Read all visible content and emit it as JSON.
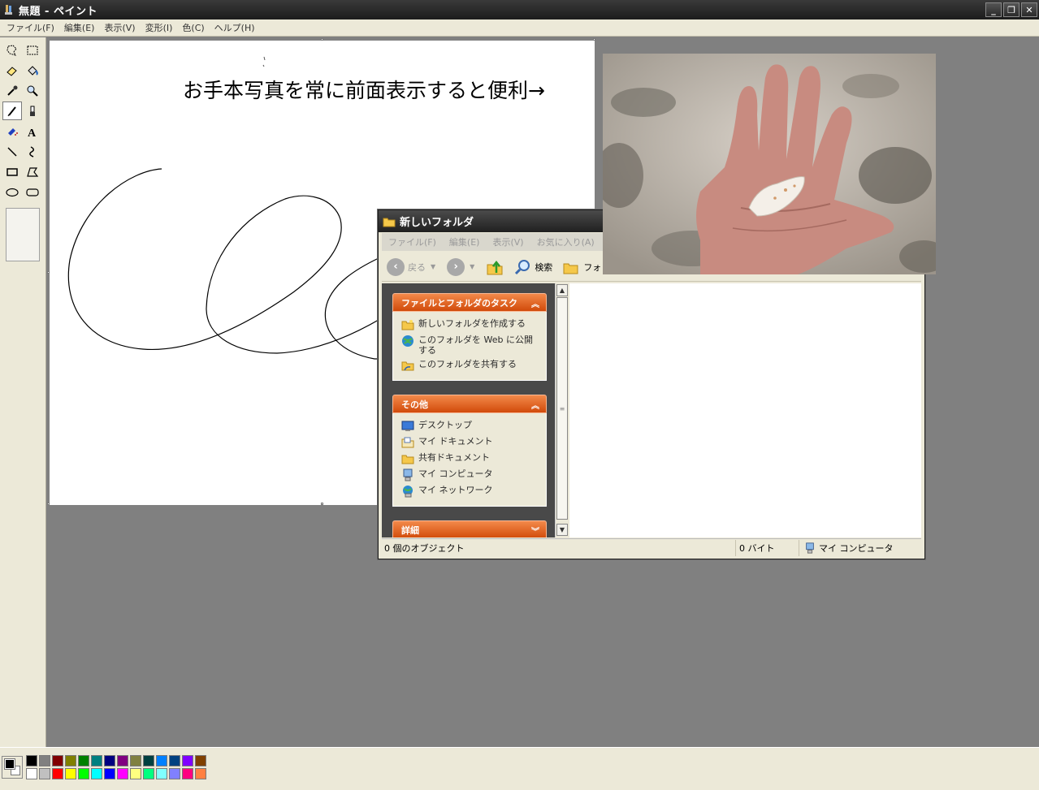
{
  "paint": {
    "title": "無題 - ペイント",
    "menus": [
      "ファイル(F)",
      "編集(E)",
      "表示(V)",
      "変形(I)",
      "色(C)",
      "ヘルプ(H)"
    ],
    "window_buttons": {
      "minimize": "_",
      "restore": "❐",
      "close": "✕"
    },
    "canvas_caption": "お手本写真を常に前面表示すると便利→",
    "tools": [
      "free-select",
      "rect-select",
      "eraser",
      "fill",
      "color-picker",
      "magnifier",
      "pencil",
      "brush",
      "airbrush",
      "text",
      "line",
      "curve",
      "rectangle",
      "polygon",
      "ellipse",
      "rounded-rect"
    ],
    "palette": {
      "top": [
        "#000000",
        "#808080",
        "#800000",
        "#808000",
        "#008000",
        "#008080",
        "#000080",
        "#800080",
        "#808040",
        "#004040",
        "#0080ff",
        "#004080",
        "#8000ff",
        "#804000"
      ],
      "bottom": [
        "#ffffff",
        "#c0c0c0",
        "#ff0000",
        "#ffff00",
        "#00ff00",
        "#00ffff",
        "#0000ff",
        "#ff00ff",
        "#ffff80",
        "#00ff80",
        "#80ffff",
        "#8080ff",
        "#ff0080",
        "#ff8040"
      ],
      "foreground": "#000000",
      "background": "#ffffff"
    }
  },
  "explorer": {
    "title": "新しいフォルダ",
    "menus": [
      "ファイル(F)",
      "編集(E)",
      "表示(V)",
      "お気に入り(A)",
      "ツ"
    ],
    "toolbar": {
      "back": "戻る",
      "search": "検索",
      "folders": "フォ"
    },
    "panels": {
      "tasks": {
        "title": "ファイルとフォルダのタスク",
        "items": [
          "新しいフォルダを作成する",
          "このフォルダを Web に公開する",
          "このフォルダを共有する"
        ]
      },
      "other": {
        "title": "その他",
        "items": [
          "デスクトップ",
          "マイ ドキュメント",
          "共有ドキュメント",
          "マイ コンピュータ",
          "マイ ネットワーク"
        ]
      },
      "details": {
        "title": "詳細"
      }
    },
    "status": {
      "objects": "0 個のオブジェクト",
      "size": "0 バイト",
      "location": "マイ コンピュータ"
    }
  }
}
